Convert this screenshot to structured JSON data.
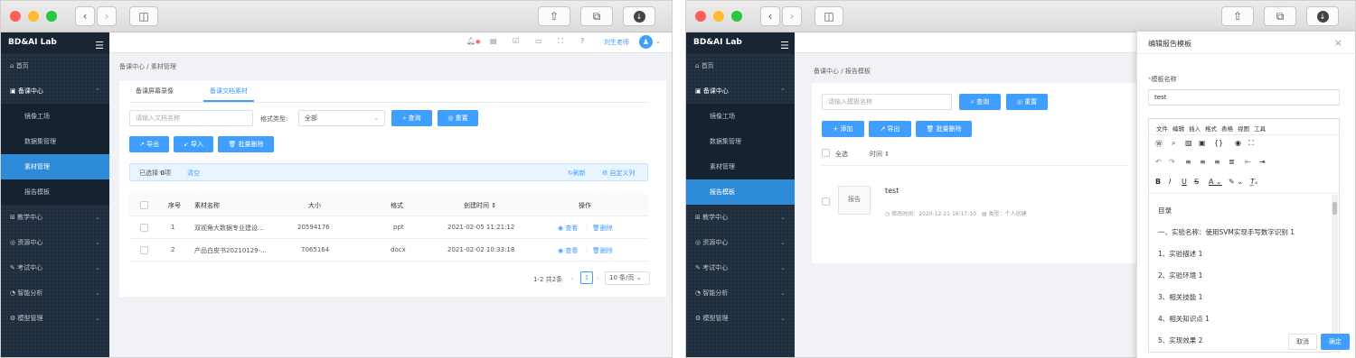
{
  "browser": {
    "back": "‹",
    "forward": "›",
    "sidebar": "◫",
    "share": "⇧",
    "tabs": "⧉",
    "download": "↓"
  },
  "brand": "BD&AI Lab",
  "menu": {
    "home": "首页",
    "prep": "备课中心",
    "mirror": "镜像工场",
    "dataset": "数据集管理",
    "material": "素材管理",
    "report": "报告模板",
    "teaching": "教学中心",
    "resource": "资源中心",
    "exam": "考试中心",
    "analysis": "智能分析",
    "model": "模型管理"
  },
  "topbar": {
    "user": "刘生老师"
  },
  "left": {
    "breadcrumb_root": "备课中心",
    "breadcrumb_sep": "/",
    "breadcrumb_current": "素材管理",
    "tab_video": "备课屏幕录像",
    "tab_doc": "备课文档素材",
    "search_placeholder": "请输入文档名称",
    "type_label": "格式类型:",
    "type_value": "全部",
    "query": "查询",
    "reset": "重置",
    "export": "导出",
    "import": "导入",
    "batch_delete": "批量删除",
    "selected_prefix": "已选择",
    "selected_count": "0",
    "selected_suffix": "项",
    "clear": "清空",
    "refresh": "刷新",
    "custom_cols": "自定义列",
    "columns": [
      "序号",
      "素材名称",
      "大小",
      "格式",
      "创建时间 ⇕",
      "操作"
    ],
    "rows": [
      {
        "no": "1",
        "name": "双视角大数据专业建设...",
        "size": "20594176",
        "fmt": "ppt",
        "time": "2021-02-05 11:21:12",
        "view": "查看",
        "del": "删除"
      },
      {
        "no": "2",
        "name": "产品白皮书20210129-...",
        "size": "7065164",
        "fmt": "docx",
        "time": "2021-02-02 10:33:18",
        "view": "查看",
        "del": "删除"
      }
    ],
    "pager_info": "1-2 共2条",
    "pager_page": "1",
    "pager_size": "10 条/页"
  },
  "right": {
    "breadcrumb_root": "备课中心",
    "breadcrumb_sep": "/",
    "breadcrumb_current": "报告模板",
    "search_placeholder": "请输入模板名称",
    "query": "查询",
    "reset": "重置",
    "add": "添加",
    "export": "导出",
    "batch_delete": "批量删除",
    "select_all": "全选",
    "time_sort": "时间 ⇕",
    "item_icon": "报告",
    "item_title": "test",
    "item_modified": "修改时间：2020-12-21 16:17:10",
    "item_type": "类型：个人创建"
  },
  "editor": {
    "title": "编辑报告模板",
    "close": "×",
    "name_label": "模板名称",
    "name_value": "test",
    "menubar": [
      "文件",
      "编辑",
      "插入",
      "格式",
      "表格",
      "视图",
      "工具"
    ],
    "doc_lines": [
      "目录",
      "一、实验名称：使用SVM实现手写数字识别 1",
      "1、实验描述 1",
      "2、实验环境 1",
      "3、相关技能 1",
      "4、相关知识点 1",
      "5、实现效果 2"
    ],
    "cancel": "取消",
    "confirm": "确定"
  }
}
